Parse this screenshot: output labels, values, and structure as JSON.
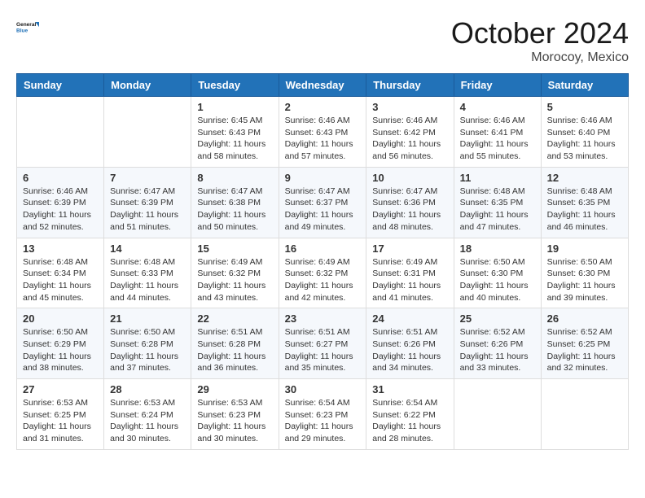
{
  "logo": {
    "line1": "General",
    "line2": "Blue"
  },
  "title": "October 2024",
  "location": "Morocoy, Mexico",
  "weekdays": [
    "Sunday",
    "Monday",
    "Tuesday",
    "Wednesday",
    "Thursday",
    "Friday",
    "Saturday"
  ],
  "weeks": [
    [
      {
        "day": "",
        "sunrise": "",
        "sunset": "",
        "daylight": ""
      },
      {
        "day": "",
        "sunrise": "",
        "sunset": "",
        "daylight": ""
      },
      {
        "day": "1",
        "sunrise": "Sunrise: 6:45 AM",
        "sunset": "Sunset: 6:43 PM",
        "daylight": "Daylight: 11 hours and 58 minutes."
      },
      {
        "day": "2",
        "sunrise": "Sunrise: 6:46 AM",
        "sunset": "Sunset: 6:43 PM",
        "daylight": "Daylight: 11 hours and 57 minutes."
      },
      {
        "day": "3",
        "sunrise": "Sunrise: 6:46 AM",
        "sunset": "Sunset: 6:42 PM",
        "daylight": "Daylight: 11 hours and 56 minutes."
      },
      {
        "day": "4",
        "sunrise": "Sunrise: 6:46 AM",
        "sunset": "Sunset: 6:41 PM",
        "daylight": "Daylight: 11 hours and 55 minutes."
      },
      {
        "day": "5",
        "sunrise": "Sunrise: 6:46 AM",
        "sunset": "Sunset: 6:40 PM",
        "daylight": "Daylight: 11 hours and 53 minutes."
      }
    ],
    [
      {
        "day": "6",
        "sunrise": "Sunrise: 6:46 AM",
        "sunset": "Sunset: 6:39 PM",
        "daylight": "Daylight: 11 hours and 52 minutes."
      },
      {
        "day": "7",
        "sunrise": "Sunrise: 6:47 AM",
        "sunset": "Sunset: 6:39 PM",
        "daylight": "Daylight: 11 hours and 51 minutes."
      },
      {
        "day": "8",
        "sunrise": "Sunrise: 6:47 AM",
        "sunset": "Sunset: 6:38 PM",
        "daylight": "Daylight: 11 hours and 50 minutes."
      },
      {
        "day": "9",
        "sunrise": "Sunrise: 6:47 AM",
        "sunset": "Sunset: 6:37 PM",
        "daylight": "Daylight: 11 hours and 49 minutes."
      },
      {
        "day": "10",
        "sunrise": "Sunrise: 6:47 AM",
        "sunset": "Sunset: 6:36 PM",
        "daylight": "Daylight: 11 hours and 48 minutes."
      },
      {
        "day": "11",
        "sunrise": "Sunrise: 6:48 AM",
        "sunset": "Sunset: 6:35 PM",
        "daylight": "Daylight: 11 hours and 47 minutes."
      },
      {
        "day": "12",
        "sunrise": "Sunrise: 6:48 AM",
        "sunset": "Sunset: 6:35 PM",
        "daylight": "Daylight: 11 hours and 46 minutes."
      }
    ],
    [
      {
        "day": "13",
        "sunrise": "Sunrise: 6:48 AM",
        "sunset": "Sunset: 6:34 PM",
        "daylight": "Daylight: 11 hours and 45 minutes."
      },
      {
        "day": "14",
        "sunrise": "Sunrise: 6:48 AM",
        "sunset": "Sunset: 6:33 PM",
        "daylight": "Daylight: 11 hours and 44 minutes."
      },
      {
        "day": "15",
        "sunrise": "Sunrise: 6:49 AM",
        "sunset": "Sunset: 6:32 PM",
        "daylight": "Daylight: 11 hours and 43 minutes."
      },
      {
        "day": "16",
        "sunrise": "Sunrise: 6:49 AM",
        "sunset": "Sunset: 6:32 PM",
        "daylight": "Daylight: 11 hours and 42 minutes."
      },
      {
        "day": "17",
        "sunrise": "Sunrise: 6:49 AM",
        "sunset": "Sunset: 6:31 PM",
        "daylight": "Daylight: 11 hours and 41 minutes."
      },
      {
        "day": "18",
        "sunrise": "Sunrise: 6:50 AM",
        "sunset": "Sunset: 6:30 PM",
        "daylight": "Daylight: 11 hours and 40 minutes."
      },
      {
        "day": "19",
        "sunrise": "Sunrise: 6:50 AM",
        "sunset": "Sunset: 6:30 PM",
        "daylight": "Daylight: 11 hours and 39 minutes."
      }
    ],
    [
      {
        "day": "20",
        "sunrise": "Sunrise: 6:50 AM",
        "sunset": "Sunset: 6:29 PM",
        "daylight": "Daylight: 11 hours and 38 minutes."
      },
      {
        "day": "21",
        "sunrise": "Sunrise: 6:50 AM",
        "sunset": "Sunset: 6:28 PM",
        "daylight": "Daylight: 11 hours and 37 minutes."
      },
      {
        "day": "22",
        "sunrise": "Sunrise: 6:51 AM",
        "sunset": "Sunset: 6:28 PM",
        "daylight": "Daylight: 11 hours and 36 minutes."
      },
      {
        "day": "23",
        "sunrise": "Sunrise: 6:51 AM",
        "sunset": "Sunset: 6:27 PM",
        "daylight": "Daylight: 11 hours and 35 minutes."
      },
      {
        "day": "24",
        "sunrise": "Sunrise: 6:51 AM",
        "sunset": "Sunset: 6:26 PM",
        "daylight": "Daylight: 11 hours and 34 minutes."
      },
      {
        "day": "25",
        "sunrise": "Sunrise: 6:52 AM",
        "sunset": "Sunset: 6:26 PM",
        "daylight": "Daylight: 11 hours and 33 minutes."
      },
      {
        "day": "26",
        "sunrise": "Sunrise: 6:52 AM",
        "sunset": "Sunset: 6:25 PM",
        "daylight": "Daylight: 11 hours and 32 minutes."
      }
    ],
    [
      {
        "day": "27",
        "sunrise": "Sunrise: 6:53 AM",
        "sunset": "Sunset: 6:25 PM",
        "daylight": "Daylight: 11 hours and 31 minutes."
      },
      {
        "day": "28",
        "sunrise": "Sunrise: 6:53 AM",
        "sunset": "Sunset: 6:24 PM",
        "daylight": "Daylight: 11 hours and 30 minutes."
      },
      {
        "day": "29",
        "sunrise": "Sunrise: 6:53 AM",
        "sunset": "Sunset: 6:23 PM",
        "daylight": "Daylight: 11 hours and 30 minutes."
      },
      {
        "day": "30",
        "sunrise": "Sunrise: 6:54 AM",
        "sunset": "Sunset: 6:23 PM",
        "daylight": "Daylight: 11 hours and 29 minutes."
      },
      {
        "day": "31",
        "sunrise": "Sunrise: 6:54 AM",
        "sunset": "Sunset: 6:22 PM",
        "daylight": "Daylight: 11 hours and 28 minutes."
      },
      {
        "day": "",
        "sunrise": "",
        "sunset": "",
        "daylight": ""
      },
      {
        "day": "",
        "sunrise": "",
        "sunset": "",
        "daylight": ""
      }
    ]
  ]
}
